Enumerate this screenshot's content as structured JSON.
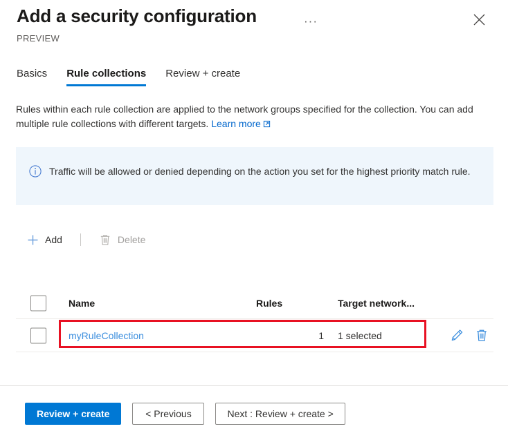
{
  "header": {
    "title": "Add a security configuration",
    "preview_label": "PREVIEW",
    "ellipsis_label": "···",
    "more_icon": "ellipsis-icon",
    "close_icon": "close-icon"
  },
  "tabs": [
    {
      "label": "Basics",
      "active": false
    },
    {
      "label": "Rule collections",
      "active": true
    },
    {
      "label": "Review + create",
      "active": false
    }
  ],
  "description": {
    "line1": "Rules within each rule collection are applied to the network groups specified for the collection.",
    "line2": "You can add multiple rule collections with different targets.",
    "learn_more": "Learn more",
    "learn_more_icon": "external-link-icon"
  },
  "info_banner": {
    "icon": "info-circle-icon",
    "text": "Traffic will be allowed or denied depending on the action you set for the highest priority match rule.",
    "background": "#eff6fc"
  },
  "commandbar": {
    "add": {
      "label": "Add",
      "icon": "plus-icon",
      "disabled": false
    },
    "delete": {
      "label": "Delete",
      "icon": "trash-icon",
      "disabled": true
    }
  },
  "table": {
    "select_all_checkbox": "unchecked",
    "columns": [
      "Name",
      "Rules",
      "Target network..."
    ],
    "rows": [
      {
        "checkbox": "unchecked",
        "name": "myRuleCollection",
        "rules": "1",
        "target_networks": "1 selected",
        "edit_icon": "pencil-icon",
        "delete_icon": "trash-icon"
      }
    ]
  },
  "annotation": {
    "highlight_color": "#e81123"
  },
  "footer": {
    "primary": "Review + create",
    "previous": "< Previous",
    "next": "Next : Review + create >"
  },
  "colors": {
    "accent": "#0078d4",
    "link": "#0066cc",
    "banner_bg": "#eff6fc",
    "highlight": "#e81123"
  }
}
